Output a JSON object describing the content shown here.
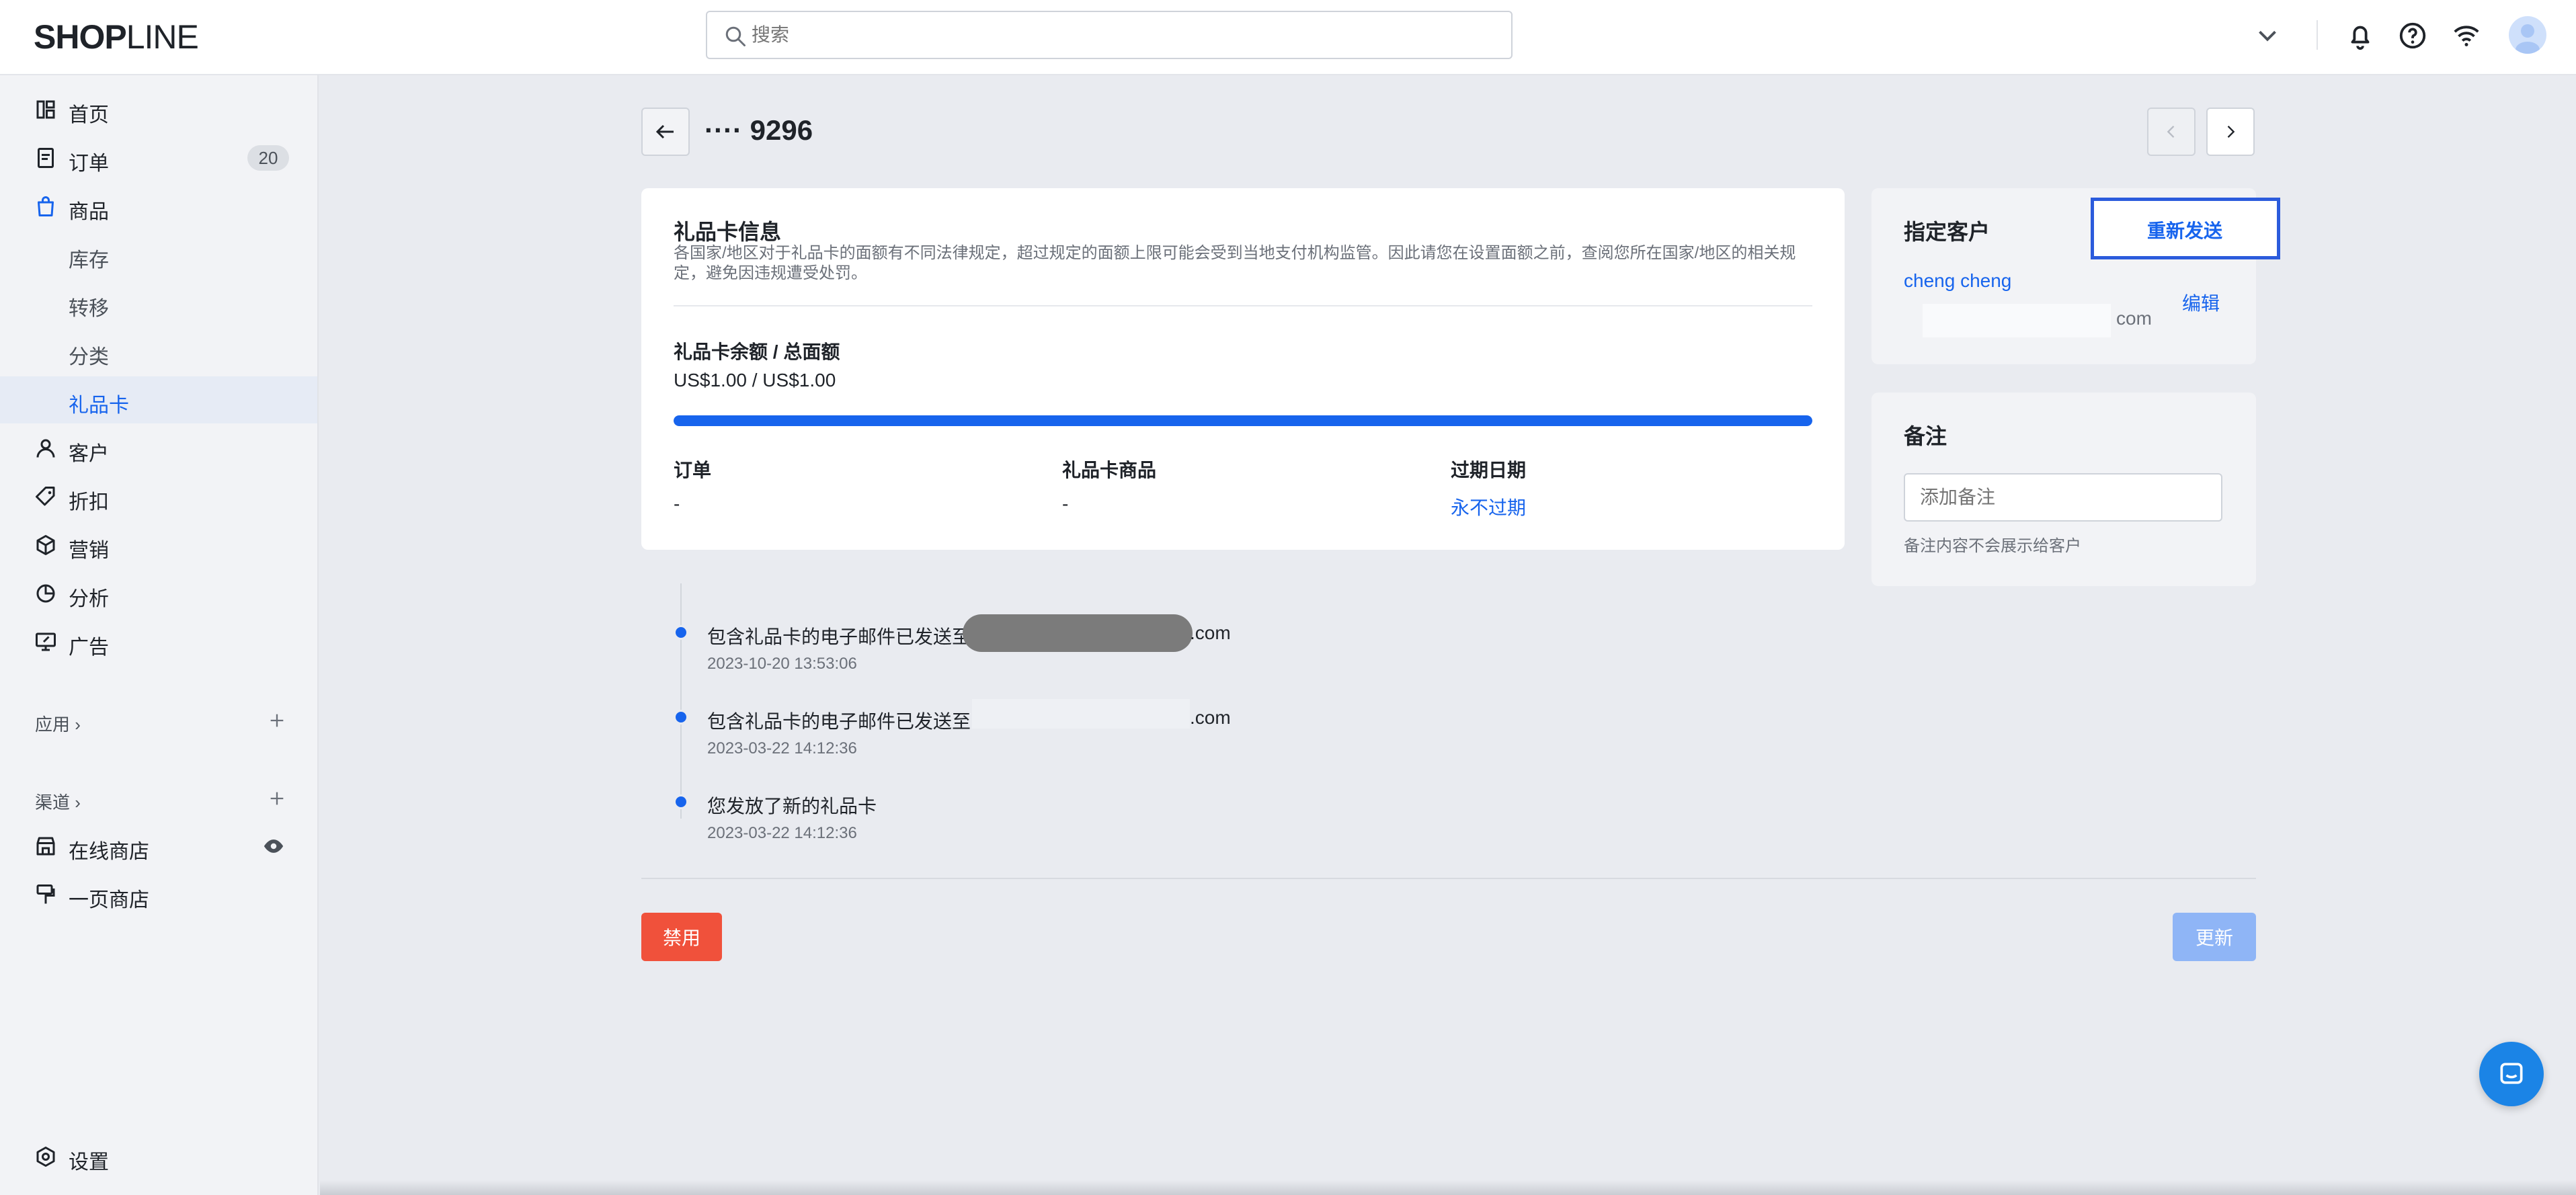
{
  "app": {
    "logo_bold": "SHOP",
    "logo_thin": "LINE",
    "search_placeholder": "搜索"
  },
  "sidebar": {
    "items": [
      {
        "label": "首页",
        "icon": "home-icon"
      },
      {
        "label": "订单",
        "icon": "orders-icon",
        "badge": "20"
      },
      {
        "label": "商品",
        "icon": "products-bag-icon"
      },
      {
        "label": "库存"
      },
      {
        "label": "转移"
      },
      {
        "label": "分类"
      },
      {
        "label": "礼品卡",
        "active": true
      },
      {
        "label": "客户",
        "icon": "customer-icon"
      },
      {
        "label": "折扣",
        "icon": "tag-icon"
      },
      {
        "label": "营销",
        "icon": "marketing-icon"
      },
      {
        "label": "分析",
        "icon": "analytics-icon"
      },
      {
        "label": "广告",
        "icon": "ads-icon"
      }
    ],
    "apps_label": "应用",
    "channels_label": "渠道",
    "channels": [
      {
        "label": "在线商店",
        "icon": "store-icon"
      },
      {
        "label": "一页商店",
        "icon": "one-page-store-icon"
      }
    ],
    "settings_label": "设置"
  },
  "page": {
    "title": "···· 9296"
  },
  "gift_card": {
    "section_title": "礼品卡信息",
    "notice": "各国家/地区对于礼品卡的面额有不同法律规定，超过规定的面额上限可能会受到当地支付机构监管。因此请您在设置面额之前，查阅您所在国家/地区的相关规定，避免因违规遭受处罚。",
    "balance_label": "礼品卡余额 / 总面额",
    "balance_value": "US$1.00 / US$1.00",
    "balance_fraction": 1.0,
    "order_label": "订单",
    "order_value": "-",
    "product_label": "礼品卡商品",
    "product_value": "-",
    "expiry_label": "过期日期",
    "expiry_value": "永不过期"
  },
  "timeline": [
    {
      "text": "包含礼品卡的电子邮件已发送至",
      "suffix": ".com",
      "time": "2023-10-20 13:53:06"
    },
    {
      "text": "包含礼品卡的电子邮件已发送至",
      "suffix": ".com",
      "time": "2023-03-22 14:12:36"
    },
    {
      "text": "您发放了新的礼品卡",
      "suffix": "",
      "time": "2023-03-22 14:12:36"
    }
  ],
  "customer": {
    "title": "指定客户",
    "resend_label": "重新发送",
    "name": "cheng cheng",
    "email_suffix": "com",
    "edit_label": "编辑"
  },
  "notes": {
    "title": "备注",
    "placeholder": "添加备注",
    "hint": "备注内容不会展示给客户"
  },
  "actions": {
    "disable_label": "禁用",
    "update_label": "更新"
  },
  "colors": {
    "accent": "#1764ed",
    "danger": "#f0513b",
    "disabled_primary": "#8fb5f6"
  }
}
